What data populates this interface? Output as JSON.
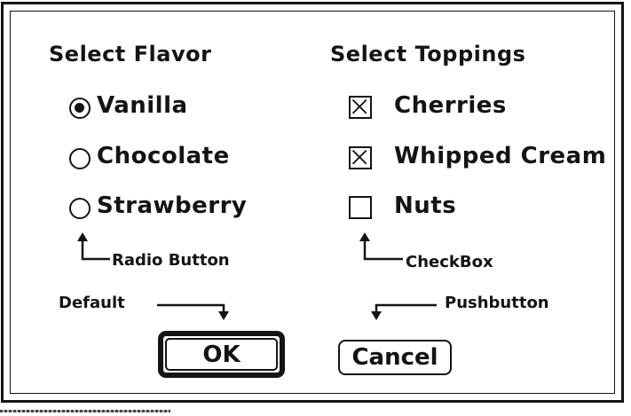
{
  "dialog": {
    "flavor": {
      "heading": "Select Flavor",
      "options": [
        {
          "label": "Vanilla",
          "selected": true
        },
        {
          "label": "Chocolate",
          "selected": false
        },
        {
          "label": "Strawberry",
          "selected": false
        }
      ]
    },
    "toppings": {
      "heading": "Select Toppings",
      "options": [
        {
          "label": "Cherries",
          "checked": true
        },
        {
          "label": "Whipped Cream",
          "checked": true
        },
        {
          "label": "Nuts",
          "checked": false
        }
      ]
    },
    "callouts": {
      "radio_button": "Radio Button",
      "checkbox": "CheckBox",
      "default": "Default",
      "pushbutton": "Pushbutton"
    },
    "buttons": {
      "ok_label": "OK",
      "cancel_label": "Cancel"
    }
  },
  "colors": {
    "ink": "#141414",
    "background": "#ffffff"
  },
  "icons": {
    "radio_selected": "radio-selected-icon",
    "radio_empty": "radio-empty-icon",
    "checkbox_checked": "checkbox-checked-icon",
    "checkbox_empty": "checkbox-empty-icon",
    "callout_arrow": "callout-arrow-icon"
  }
}
